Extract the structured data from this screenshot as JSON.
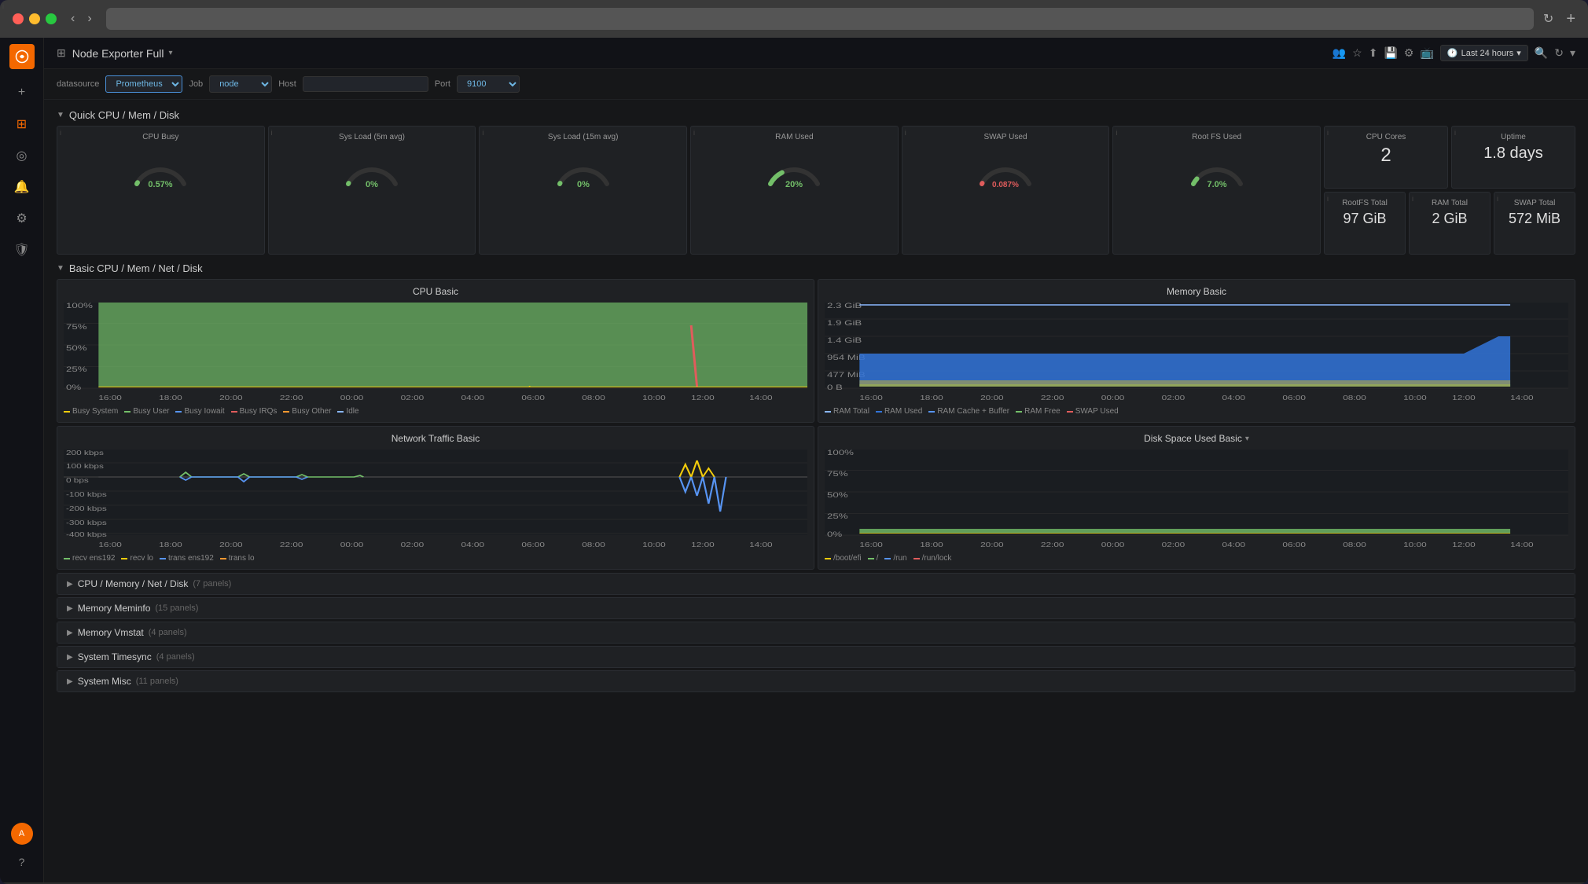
{
  "browser": {
    "url": ""
  },
  "topbar": {
    "dashboard_title": "Node Exporter Full",
    "time_range": "Last 24 hours",
    "icons": [
      "users-icon",
      "star-icon",
      "share-icon",
      "save-icon",
      "settings-icon",
      "monitor-icon",
      "clock-icon",
      "search-icon",
      "refresh-icon"
    ]
  },
  "filterbar": {
    "datasource_label": "datasource",
    "datasource_value": "Prometheus",
    "job_label": "Job",
    "job_value": "node",
    "host_label": "Host",
    "host_value": "",
    "port_label": "Port",
    "port_value": "9100"
  },
  "quick_cpu_section": {
    "title": "Quick CPU / Mem / Disk",
    "cards": [
      {
        "title": "CPU Busy",
        "value": "0.57%",
        "type": "gauge",
        "color": "#73bf69",
        "pct": 0.57
      },
      {
        "title": "Sys Load (5m avg)",
        "value": "0%",
        "type": "gauge",
        "color": "#73bf69",
        "pct": 0
      },
      {
        "title": "Sys Load (15m avg)",
        "value": "0%",
        "type": "gauge",
        "color": "#73bf69",
        "pct": 0
      },
      {
        "title": "RAM Used",
        "value": "20%",
        "type": "gauge",
        "color": "#73bf69",
        "pct": 20
      },
      {
        "title": "SWAP Used",
        "value": "0.087%",
        "type": "gauge",
        "color": "#e05c5c",
        "pct": 0.087
      },
      {
        "title": "Root FS Used",
        "value": "7.0%",
        "type": "gauge",
        "color": "#73bf69",
        "pct": 7.0
      }
    ],
    "right_cards": [
      {
        "title": "CPU Cores",
        "value": "2"
      },
      {
        "title": "Uptime",
        "value": "1.8 days"
      },
      {
        "title": "RootFS Total",
        "value": "97 GiB"
      },
      {
        "title": "RAM Total",
        "value": "2 GiB"
      },
      {
        "title": "SWAP Total",
        "value": "572 MiB"
      }
    ]
  },
  "basic_section": {
    "title": "Basic CPU / Mem / Net / Disk",
    "cpu_chart": {
      "title": "CPU Basic",
      "y_labels": [
        "100%",
        "75%",
        "50%",
        "25%",
        "0%"
      ],
      "x_labels": [
        "16:00",
        "18:00",
        "20:00",
        "22:00",
        "00:00",
        "02:00",
        "04:00",
        "06:00",
        "08:00",
        "10:00",
        "12:00",
        "14:00"
      ],
      "legend": [
        {
          "label": "Busy System",
          "color": "#f2cc0c"
        },
        {
          "label": "Busy User",
          "color": "#73bf69"
        },
        {
          "label": "Busy Iowait",
          "color": "#5794f2"
        },
        {
          "label": "Busy IRQs",
          "color": "#e05c5c"
        },
        {
          "label": "Busy Other",
          "color": "#ff9830"
        },
        {
          "label": "Idle",
          "color": "#8ab8ff"
        }
      ]
    },
    "memory_chart": {
      "title": "Memory Basic",
      "y_labels": [
        "2.3 GiB",
        "1.9 GiB",
        "1.4 GiB",
        "954 MiB",
        "477 MiB",
        "0 B"
      ],
      "x_labels": [
        "16:00",
        "18:00",
        "20:00",
        "22:00",
        "00:00",
        "02:00",
        "04:00",
        "06:00",
        "08:00",
        "10:00",
        "12:00",
        "14:00"
      ],
      "legend": [
        {
          "label": "RAM Total",
          "color": "#8ab8ff"
        },
        {
          "label": "RAM Used",
          "color": "#3274d9"
        },
        {
          "label": "RAM Cache + Buffer",
          "color": "#5794f2"
        },
        {
          "label": "RAM Free",
          "color": "#73bf69"
        },
        {
          "label": "SWAP Used",
          "color": "#e05c5c"
        }
      ]
    },
    "network_chart": {
      "title": "Network Traffic Basic",
      "y_labels": [
        "200 kbps",
        "100 kbps",
        "0 bps",
        "-100 kbps",
        "-200 kbps",
        "-300 kbps",
        "-400 kbps"
      ],
      "x_labels": [
        "16:00",
        "18:00",
        "20:00",
        "22:00",
        "00:00",
        "02:00",
        "04:00",
        "06:00",
        "08:00",
        "10:00",
        "12:00",
        "14:00"
      ],
      "legend": [
        {
          "label": "recv ens192",
          "color": "#73bf69"
        },
        {
          "label": "recv lo",
          "color": "#f2cc0c"
        },
        {
          "label": "trans ens192",
          "color": "#5794f2"
        },
        {
          "label": "trans lo",
          "color": "#ff9830"
        }
      ]
    },
    "disk_chart": {
      "title": "Disk Space Used Basic",
      "y_labels": [
        "100%",
        "75%",
        "50%",
        "25%",
        "0%"
      ],
      "x_labels": [
        "16:00",
        "18:00",
        "20:00",
        "22:00",
        "00:00",
        "02:00",
        "04:00",
        "06:00",
        "08:00",
        "10:00",
        "12:00",
        "14:00"
      ],
      "legend": [
        {
          "label": "/boot/efi",
          "color": "#f2cc0c"
        },
        {
          "label": "/",
          "color": "#73bf69"
        },
        {
          "label": "/run",
          "color": "#5794f2"
        },
        {
          "label": "/run/lock",
          "color": "#e05c5c"
        }
      ]
    }
  },
  "collapsible_sections": [
    {
      "title": "CPU / Memory / Net / Disk",
      "panel_count": "7 panels"
    },
    {
      "title": "Memory Meminfo",
      "panel_count": "15 panels"
    },
    {
      "title": "Memory Vmstat",
      "panel_count": "4 panels"
    },
    {
      "title": "System Timesync",
      "panel_count": "4 panels"
    },
    {
      "title": "System Misc",
      "panel_count": "11 panels"
    }
  ],
  "colors": {
    "bg_dark": "#161719",
    "bg_card": "#1f2124",
    "border": "#2a2d32",
    "accent_green": "#73bf69",
    "accent_yellow": "#f2cc0c",
    "accent_blue": "#5794f2",
    "accent_red": "#e05c5c",
    "accent_orange": "#ff9830",
    "text_primary": "#d0d0d0",
    "text_muted": "#888"
  }
}
